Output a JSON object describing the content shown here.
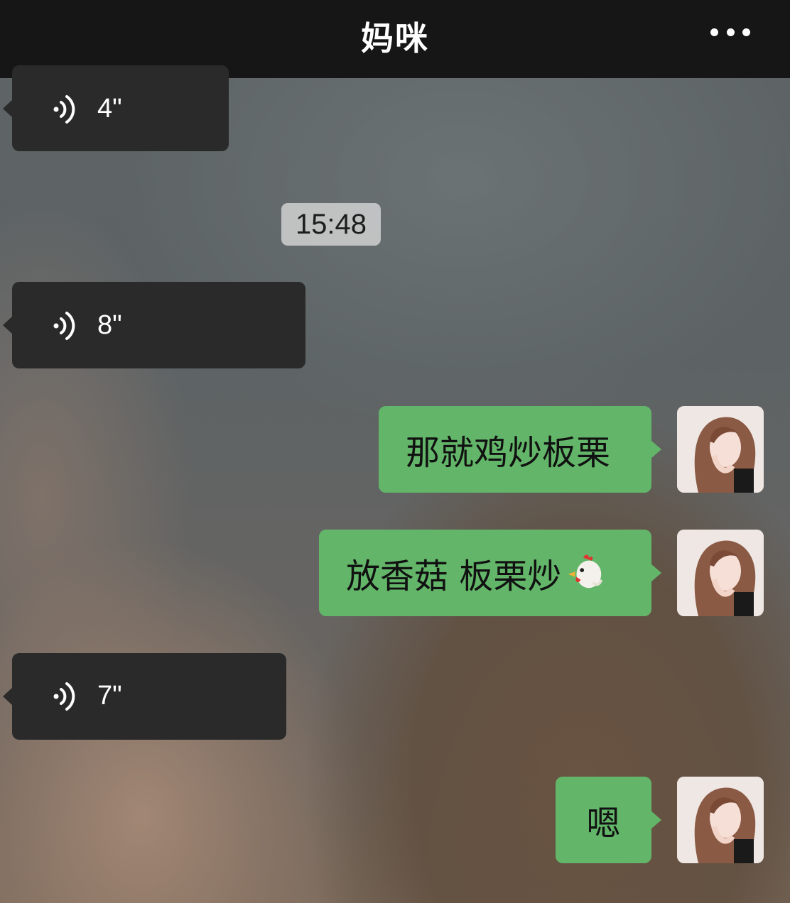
{
  "header": {
    "title": "妈咪",
    "more_icon": "more-horizontal-icon"
  },
  "messages": {
    "voice1": {
      "duration": "4\"",
      "icon": "voice-wave-icon"
    },
    "time_divider": "15:48",
    "voice2": {
      "duration": "8\"",
      "icon": "voice-wave-icon"
    },
    "text1": "那就鸡炒板栗",
    "text2": "放香菇 板栗炒",
    "text2_emoji": "chicken-emoji-icon",
    "voice3": {
      "duration": "7\"",
      "icon": "voice-wave-icon"
    },
    "text3": "嗯"
  },
  "colors": {
    "outgoing_bubble": "#63b669",
    "incoming_voice_bubble": "#2a2a2a",
    "topbar": "#161616"
  }
}
